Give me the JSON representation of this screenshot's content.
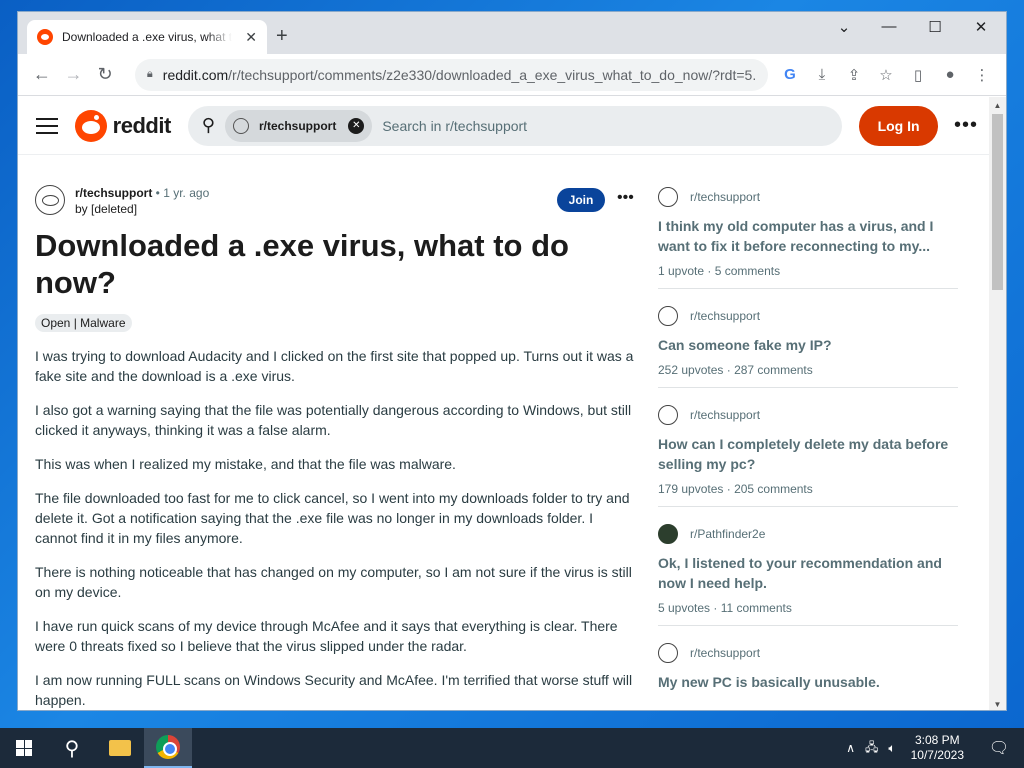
{
  "browser": {
    "tab_title": "Downloaded a .exe virus, what to do now? : r/techsupport",
    "tab_close": "✕",
    "new_tab": "+",
    "min": "⌄",
    "minimize": "—",
    "maximize": "☐",
    "close": "✕",
    "url_host": "reddit.com",
    "url_path": "/r/techsupport/comments/z2e330/downloaded_a_exe_virus_what_to_do_now/?rdt=5..."
  },
  "header": {
    "logo_text": "reddit",
    "chip_label": "r/techsupport",
    "search_placeholder": "Search in r/techsupport",
    "login_label": "Log In"
  },
  "post": {
    "subreddit": "r/techsupport",
    "age": "1 yr. ago",
    "author": "by [deleted]",
    "join_label": "Join",
    "title": "Downloaded a .exe virus, what to do now?",
    "flair": "Open | Malware",
    "paragraphs": [
      "I was trying to download Audacity and I clicked on the first site that popped up. Turns out it was a fake site and the download is a .exe virus.",
      "I also got a warning saying that the file was potentially dangerous according to Windows, but still clicked it anyways, thinking it was a false alarm.",
      "This was when I realized my mistake, and that the file was malware.",
      "The file downloaded too fast for me to click cancel, so I went into my downloads folder to try and delete it. Got a notification saying that the .exe file was no longer in my downloads folder. I cannot find it in my files anymore.",
      "There is nothing noticeable that has changed on my computer, so I am not sure if the virus is still on my device.",
      "I have run quick scans of my device through McAfee and it says that everything is clear. There were 0 threats fixed so I believe that the virus slipped under the radar.",
      "I am now running FULL scans on Windows Security and McAfee. I'm terrified that worse stuff will happen."
    ]
  },
  "sidebar": {
    "cards": [
      {
        "sub": "r/techsupport",
        "title": "I think my old computer has a virus, and I want to fix it before reconnecting to my...",
        "upvotes": "1 upvote",
        "comments": "5 comments"
      },
      {
        "sub": "r/techsupport",
        "title": "Can someone fake my IP?",
        "upvotes": "252 upvotes",
        "comments": "287 comments"
      },
      {
        "sub": "r/techsupport",
        "title": "How can I completely delete my data before selling my pc?",
        "upvotes": "179 upvotes",
        "comments": "205 comments"
      },
      {
        "sub": "r/Pathfinder2e",
        "title": "Ok, I listened to your recommendation and now I need help.",
        "upvotes": "5 upvotes",
        "comments": "11 comments"
      },
      {
        "sub": "r/techsupport",
        "title": "My new PC is basically unusable.",
        "upvotes": "",
        "comments": ""
      }
    ]
  },
  "taskbar": {
    "time": "3:08 PM",
    "date": "10/7/2023"
  }
}
